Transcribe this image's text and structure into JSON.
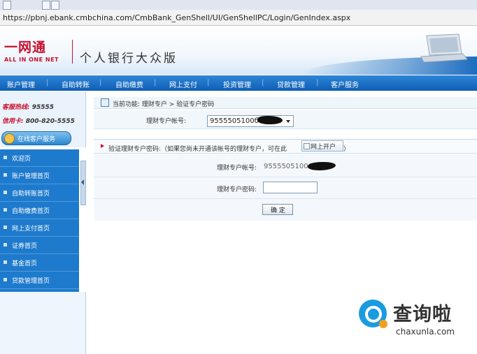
{
  "browser": {
    "address": "https://pbnj.ebank.cmbchina.com/CmbBank_GenShell/UI/GenShellPC/Login/GenIndex.aspx"
  },
  "banner": {
    "logo_cn": "一网通",
    "logo_en": "ALL IN ONE NET",
    "title": "个人银行大众版"
  },
  "nav": {
    "items": [
      "账户管理",
      "自助转账",
      "自助缴费",
      "网上支付",
      "投资管理",
      "贷款管理",
      "客户服务"
    ]
  },
  "sidebar": {
    "hotline_label": "客服热线:",
    "hotline_value": "95555",
    "credit_label": "信用卡:",
    "credit_value": "800-820-5555",
    "service_button": "在线客户服务",
    "menu": [
      "欢迎页",
      "账户管理首页",
      "自助转账首页",
      "自助缴费首页",
      "网上支付首页",
      "证券首页",
      "基金首页",
      "贷款管理首页"
    ]
  },
  "main": {
    "breadcrumb": "当前功能: 理财专户 > 验证专户密码",
    "account_label": "理财专户帐号:",
    "account_value": "9555505100б",
    "panel_title": "验证理财专户密码:（如果您尚未开通该帐号的理财专户，可在此",
    "open_button": "网上开户",
    "panel_title_end": "）",
    "account_label2": "理财专户帐号:",
    "account_value2": "95555051006",
    "password_label": "理财专户密码:",
    "password_value": "",
    "confirm_button": "确 定"
  },
  "watermark": {
    "cn": "查询啦",
    "en": "chaxunla.com"
  }
}
